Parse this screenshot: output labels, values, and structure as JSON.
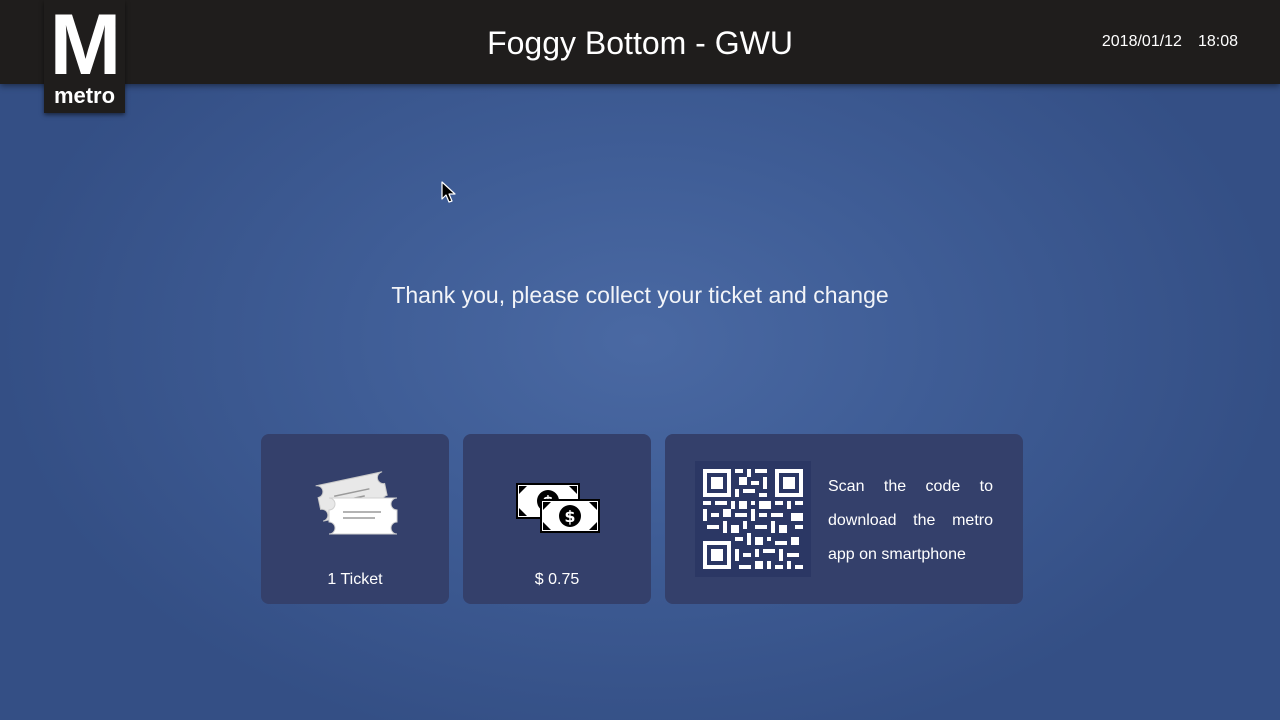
{
  "header": {
    "logo_letter": "M",
    "logo_word": "metro",
    "station": "Foggy Bottom - GWU",
    "date": "2018/01/12",
    "time": "18:08"
  },
  "main": {
    "message": "Thank you, please collect your ticket and change"
  },
  "cards": {
    "ticket": {
      "icon": "tickets-icon",
      "label": "1 Ticket"
    },
    "change": {
      "icon": "banknotes-icon",
      "label": "$ 0.75"
    },
    "app": {
      "icon": "qr-code-icon",
      "text": "Scan the code to download the metro app on smartphone"
    }
  },
  "colors": {
    "header_bg": "#1f1d1c",
    "background": "#3f5d96",
    "card_bg": "#34406b",
    "text": "#ffffff"
  }
}
